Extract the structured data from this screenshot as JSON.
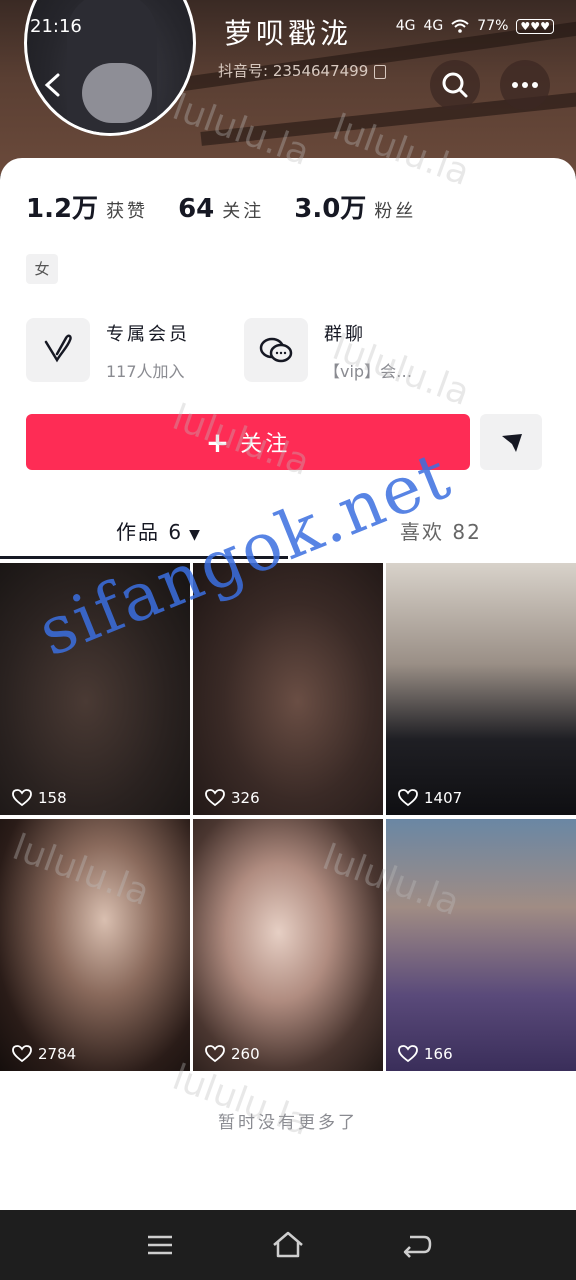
{
  "status_bar": {
    "time": "21:16",
    "signal_1": "4G",
    "signal_2": "4G",
    "battery": "77%"
  },
  "profile": {
    "name": "萝呗戳泷",
    "douyin_id": "抖音号: 2354647499"
  },
  "stats": [
    {
      "value": "1.2万",
      "label": "获赞"
    },
    {
      "value": "64",
      "label": "关注"
    },
    {
      "value": "3.0万",
      "label": "粉丝"
    }
  ],
  "gender_tag": "女",
  "features": {
    "vip": {
      "title": "专属会员",
      "subtitle": "117人加入"
    },
    "group": {
      "title": "群聊",
      "subtitle": "【vip】会…"
    }
  },
  "actions": {
    "follow_label": "关注",
    "follow_symbol": "+"
  },
  "tabs": {
    "works": "作品 6",
    "likes": "喜欢 82"
  },
  "videos": [
    {
      "likes": "158"
    },
    {
      "likes": "326"
    },
    {
      "likes": "1407"
    },
    {
      "likes": "2784"
    },
    {
      "likes": "260"
    },
    {
      "likes": "166"
    }
  ],
  "footer_text": "暂时没有更多了",
  "watermark": "sifangok.net",
  "watermark_light": "lululu.la",
  "colors": {
    "accent": "#fe2c55",
    "watermark": "#3b6fe0"
  }
}
